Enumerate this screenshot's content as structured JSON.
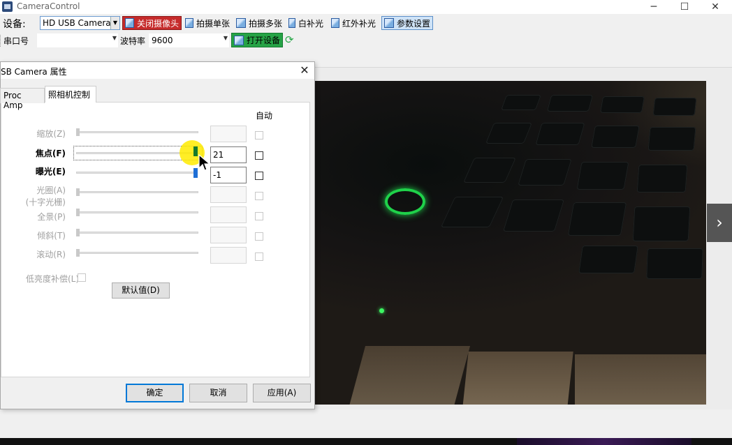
{
  "window": {
    "title": "CameraControl",
    "minimize": "─",
    "maximize": "☐",
    "close": "✕"
  },
  "toolbar": {
    "device_label": "设备:",
    "device_value": "HD USB Camera",
    "close_camera": "关闭摄像头",
    "capture_single": "拍摄单张",
    "capture_multi": "拍摄多张",
    "white_light": "白补光",
    "ir_light": "红外补光",
    "param_settings": "参数设置",
    "serial_label": "串口号",
    "serial_value": "",
    "baud_label": "波特率",
    "baud_value": "9600",
    "open_device": "打开设备",
    "dropdown_glyph": "▼",
    "refresh_glyph": "⟳"
  },
  "dialog": {
    "title": "SB Camera 属性",
    "close": "✕",
    "tabs": [
      "Proc Amp",
      "照相机控制"
    ],
    "auto_header": "自动",
    "controls": [
      {
        "label": "缩放(Z)",
        "value": ""
      },
      {
        "label": "焦点(F)",
        "value": "21"
      },
      {
        "label": "曝光(E)",
        "value": "-1"
      },
      {
        "label": "光圈(A)",
        "label2": "(十字光栅)",
        "value": ""
      },
      {
        "label": "全景(P)",
        "value": ""
      },
      {
        "label": "倾斜(T)",
        "value": ""
      },
      {
        "label": "滚动(R)",
        "value": ""
      }
    ],
    "low_light": "低亮度补偿(L)",
    "default_btn": "默认值(D)",
    "ok": "确定",
    "cancel": "取消",
    "apply": "应用(A)"
  },
  "viewer": {
    "next_glyph": "›"
  },
  "colors": {
    "close_camera_bg": "#c62b2b",
    "open_device_bg": "#26a346",
    "params_bg": "#cfe3f7"
  }
}
